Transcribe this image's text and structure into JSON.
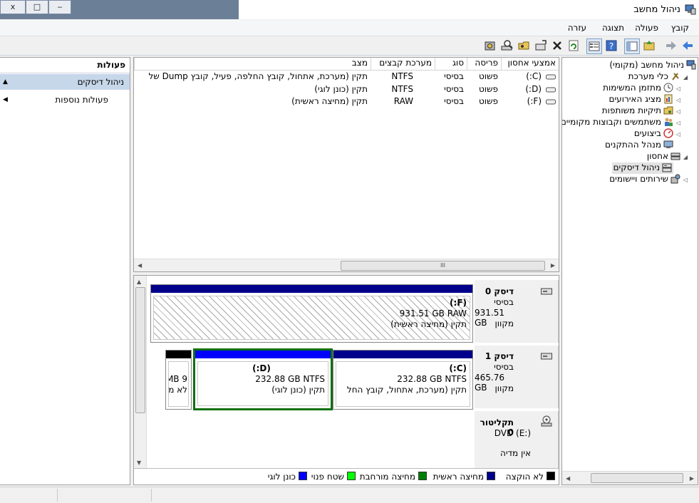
{
  "window": {
    "title": "ניהול מחשב",
    "close_glyph": "x",
    "restore_glyph": "□",
    "minimize_glyph": "‒"
  },
  "menu": {
    "items": [
      "קובץ",
      "פעולה",
      "תצוגה",
      "עזרה"
    ]
  },
  "toolbar": {
    "icons": [
      "back-arrow-icon",
      "forward-arrow-icon",
      "up-folder-icon",
      "show-hide-tree-icon",
      "help-icon",
      "properties-icon",
      "refresh-icon",
      "delete-icon",
      "connect-disk-icon",
      "open-folder-icon",
      "search-disk-icon",
      "settings-disk-icon"
    ]
  },
  "tree": {
    "items": [
      {
        "label": "ניהול מחשב (מקומי)",
        "level": 0,
        "arrow": "",
        "icon": "computer-management-icon"
      },
      {
        "label": "כלי מערכת",
        "level": 1,
        "arrow": "◢",
        "icon": "system-tools-icon"
      },
      {
        "label": "מתזמן המשימות",
        "level": 2,
        "arrow": "◁",
        "icon": "task-scheduler-icon"
      },
      {
        "label": "מציג האירועים",
        "level": 2,
        "arrow": "◁",
        "icon": "event-viewer-icon"
      },
      {
        "label": "תיקיות משותפות",
        "level": 2,
        "arrow": "◁",
        "icon": "shared-folders-icon"
      },
      {
        "label": "משתמשים וקבוצות מקומיים",
        "level": 2,
        "arrow": "◁",
        "icon": "users-groups-icon"
      },
      {
        "label": "ביצועים",
        "level": 2,
        "arrow": "◁",
        "icon": "performance-icon"
      },
      {
        "label": "מנהל ההתקנים",
        "level": 2,
        "arrow": "",
        "icon": "device-manager-icon"
      },
      {
        "label": "אחסון",
        "level": 1,
        "arrow": "◢",
        "icon": "storage-icon"
      },
      {
        "label": "ניהול דיסקים",
        "level": 2,
        "arrow": "",
        "icon": "disk-management-icon",
        "selected": true
      },
      {
        "label": "שירותים ויישומים",
        "level": 1,
        "arrow": "◁",
        "icon": "services-apps-icon"
      }
    ]
  },
  "volume_list": {
    "columns": [
      "אמצעי אחסון",
      "פריסה",
      "סוג",
      "מערכת קבצים",
      "מצב"
    ],
    "rows": [
      {
        "volume": "(C:)",
        "layout": "פשוט",
        "type": "בסיסי",
        "fs": "NTFS",
        "status": "תקין (מערכת, אתחול, קובץ החלפה, פעיל, קובץ Dump של"
      },
      {
        "volume": "(D:)",
        "layout": "פשוט",
        "type": "בסיסי",
        "fs": "NTFS",
        "status": "תקין (כונן לוגי)"
      },
      {
        "volume": "(F:)",
        "layout": "פשוט",
        "type": "בסיסי",
        "fs": "RAW",
        "status": "תקין (מחיצה ראשית)"
      }
    ],
    "scroll_grip": "III"
  },
  "disks": [
    {
      "name": "דיסק 0",
      "type": "בסיסי",
      "size": "931.51 GB",
      "state": "מקוון",
      "partitions": [
        {
          "letter": "(F:)",
          "info": "931.51 GB RAW",
          "status": "תקין (מחיצה ראשית)",
          "bar": "#00008b",
          "hatched": true
        }
      ]
    },
    {
      "name": "דיסק 1",
      "type": "בסיסי",
      "size": "465.76 GB",
      "state": "מקוון",
      "partitions": [
        {
          "letter": "(C:)",
          "info": "232.88 GB NTFS",
          "status": "תקין (מערכת, אתחול, קובץ החל",
          "bar": "#00008b"
        },
        {
          "letter": "(D:)",
          "info": "232.88 GB NTFS",
          "status": "תקין (כונן לוגי)",
          "bar": "#0000ff",
          "selected": true
        },
        {
          "letter": "",
          "info": "9 MB",
          "status": "לא מ",
          "bar": "#000000"
        }
      ]
    },
    {
      "name": "תקליטור 0",
      "type": "DVD (E:)",
      "size": "",
      "state": "אין מדיה"
    }
  ],
  "legend": [
    {
      "label": "לא הוקצה",
      "color": "#000000"
    },
    {
      "label": "מחיצה ראשית",
      "color": "#00008b"
    },
    {
      "label": "מחיצה מורחבת",
      "color": "#008000"
    },
    {
      "label": "שטח פנוי",
      "color": "#00ff00"
    },
    {
      "label": "כונן לוגי",
      "color": "#0000ff"
    }
  ],
  "actions": {
    "header": "פעולות",
    "section": "ניהול דיסקים",
    "more": "פעולות נוספות"
  }
}
